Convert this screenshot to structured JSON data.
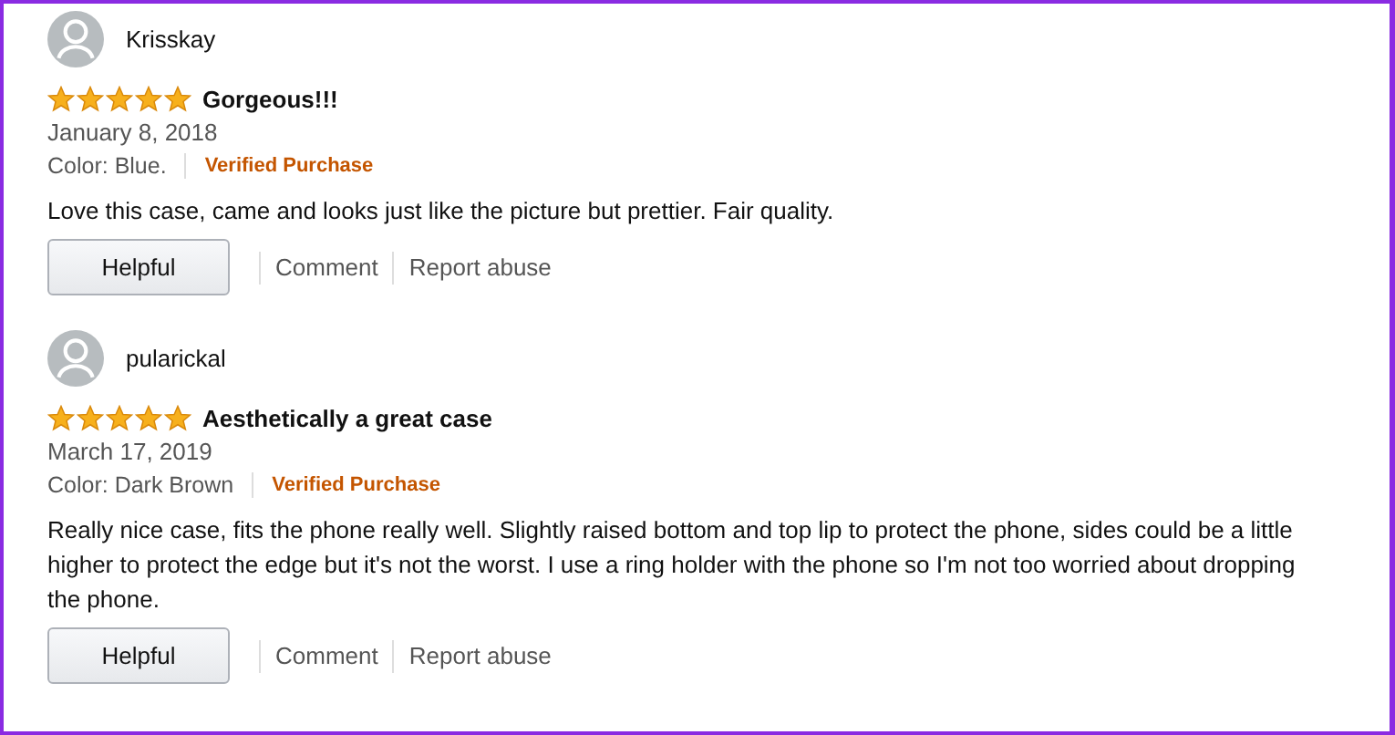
{
  "reviews": [
    {
      "author": "Krisskay",
      "stars": 5,
      "title": "Gorgeous!!!",
      "date": "January 8, 2018",
      "variant": "Color: Blue.",
      "badge": "Verified Purchase",
      "body": "Love this case, came and looks just like the picture but prettier. Fair quality.",
      "actions": {
        "helpful": "Helpful",
        "comment": "Comment",
        "report": "Report abuse"
      }
    },
    {
      "author": "pularickal",
      "stars": 5,
      "title": "Aesthetically a great case",
      "date": "March 17, 2019",
      "variant": "Color: Dark Brown",
      "badge": "Verified Purchase",
      "body": "Really nice case, fits the phone really well. Slightly raised bottom and top lip to protect the phone, sides could be a little higher to protect the edge but it's not the worst. I use a ring holder with the phone so I'm not too worried about dropping the phone.",
      "actions": {
        "helpful": "Helpful",
        "comment": "Comment",
        "report": "Report abuse"
      }
    }
  ]
}
